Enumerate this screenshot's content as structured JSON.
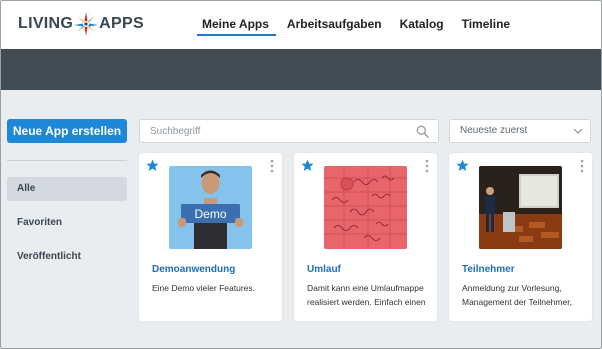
{
  "brand": {
    "part1": "LIVING",
    "part2": "APPS"
  },
  "nav": {
    "items": [
      {
        "label": "Meine Apps",
        "active": true
      },
      {
        "label": "Arbeitsaufgaben"
      },
      {
        "label": "Katalog"
      },
      {
        "label": "Timeline"
      }
    ]
  },
  "sidebar": {
    "new_app_label": "Neue App erstellen",
    "filters": [
      {
        "label": "Alle",
        "active": true
      },
      {
        "label": "Favoriten"
      },
      {
        "label": "Veröffentlicht"
      }
    ]
  },
  "search": {
    "placeholder": "Suchbegriff",
    "icon": "search-icon"
  },
  "sort": {
    "selected": "Neueste zuerst",
    "icon": "chevron-down-icon"
  },
  "colors": {
    "accent": "#1d88d8",
    "link": "#1e6fb8",
    "header_dark": "#424c55",
    "background": "#e9edf0"
  },
  "cards": [
    {
      "title": "Demoanwendung",
      "description": "Eine Demo vieler Features.",
      "thumb_label": "Demo",
      "favorite": true
    },
    {
      "title": "Umlauf",
      "description": "Damit kann eine Umlaufmappe realisiert werden. Einfach einen",
      "favorite": true
    },
    {
      "title": "Teilnehmer",
      "description": "Anmeldung zur Vorlesung, Management der Teilnehmer,",
      "favorite": true
    }
  ]
}
